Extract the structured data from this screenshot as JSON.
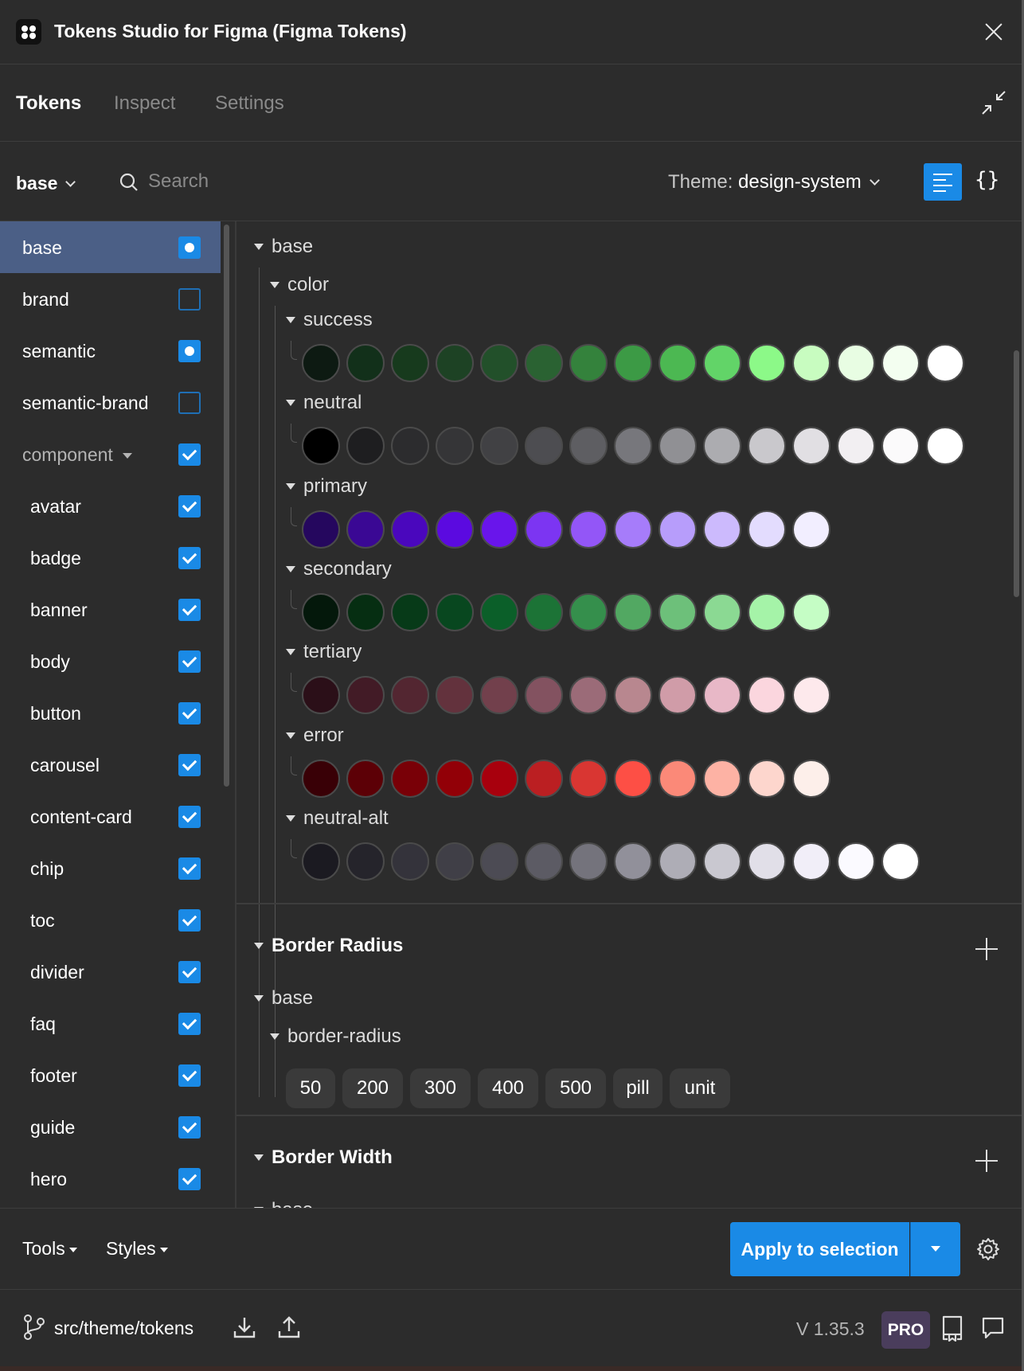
{
  "window": {
    "title": "Tokens Studio for Figma (Figma Tokens)"
  },
  "tabs": [
    {
      "label": "Tokens",
      "active": true
    },
    {
      "label": "Inspect",
      "active": false
    },
    {
      "label": "Settings",
      "active": false
    }
  ],
  "toolbar": {
    "token_set": "base",
    "search_placeholder": "Search",
    "theme_prefix": "Theme:",
    "theme_value": "design-system",
    "json_button": "{}"
  },
  "sidebar": {
    "items": [
      {
        "label": "base",
        "state": "dot",
        "selected": true,
        "child": false
      },
      {
        "label": "brand",
        "state": "empty",
        "selected": false,
        "child": false
      },
      {
        "label": "semantic",
        "state": "dot",
        "selected": false,
        "child": false
      },
      {
        "label": "semantic-brand",
        "state": "empty",
        "selected": false,
        "child": false
      },
      {
        "label": "component",
        "state": "checked",
        "selected": false,
        "child": false,
        "folder": true
      },
      {
        "label": "avatar",
        "state": "checked",
        "selected": false,
        "child": true
      },
      {
        "label": "badge",
        "state": "checked",
        "selected": false,
        "child": true
      },
      {
        "label": "banner",
        "state": "checked",
        "selected": false,
        "child": true
      },
      {
        "label": "body",
        "state": "checked",
        "selected": false,
        "child": true
      },
      {
        "label": "button",
        "state": "checked",
        "selected": false,
        "child": true
      },
      {
        "label": "carousel",
        "state": "checked",
        "selected": false,
        "child": true
      },
      {
        "label": "content-card",
        "state": "checked",
        "selected": false,
        "child": true
      },
      {
        "label": "chip",
        "state": "checked",
        "selected": false,
        "child": true
      },
      {
        "label": "toc",
        "state": "checked",
        "selected": false,
        "child": true
      },
      {
        "label": "divider",
        "state": "checked",
        "selected": false,
        "child": true
      },
      {
        "label": "faq",
        "state": "checked",
        "selected": false,
        "child": true
      },
      {
        "label": "footer",
        "state": "checked",
        "selected": false,
        "child": true
      },
      {
        "label": "guide",
        "state": "checked",
        "selected": false,
        "child": true
      },
      {
        "label": "hero",
        "state": "checked",
        "selected": false,
        "child": true
      }
    ]
  },
  "colors_section": {
    "root_label": "base",
    "sub_label": "color",
    "groups": [
      {
        "name": "success",
        "swatches": [
          "#0d1a12",
          "#12301a",
          "#173a1d",
          "#1d4224",
          "#22502a",
          "#2a6232",
          "#34823c",
          "#3c9a45",
          "#4cb852",
          "#62d468",
          "#8cf988",
          "#c8fcc0",
          "#e8fde3",
          "#f3fef0",
          "#ffffff"
        ]
      },
      {
        "name": "neutral",
        "swatches": [
          "#000000",
          "#1e1e20",
          "#2c2c2e",
          "#353537",
          "#414144",
          "#4d4d51",
          "#5e5e62",
          "#77777c",
          "#909094",
          "#acacb0",
          "#c9c8cc",
          "#e1dfe3",
          "#f2eff2",
          "#fbfafb",
          "#ffffff"
        ]
      },
      {
        "name": "primary",
        "swatches": [
          "#25075e",
          "#3a0894",
          "#4a07bd",
          "#5b0ae0",
          "#6915eb",
          "#7c35f2",
          "#9356f7",
          "#a67cfa",
          "#b79dfb",
          "#ccbafd",
          "#e3dcfe",
          "#f2eeff"
        ]
      },
      {
        "name": "secondary",
        "swatches": [
          "#04180b",
          "#062e12",
          "#073a18",
          "#08471f",
          "#0b5f29",
          "#1c7336",
          "#358f4c",
          "#52a862",
          "#6dc07a",
          "#8bd993",
          "#a5f3a8",
          "#c5fdc5"
        ]
      },
      {
        "name": "tertiary",
        "swatches": [
          "#2b0f18",
          "#421b26",
          "#532631",
          "#63323d",
          "#72404c",
          "#835260",
          "#9b6b78",
          "#b8878f",
          "#d09ca8",
          "#e8b8c7",
          "#fbd6de",
          "#fde9ec"
        ]
      },
      {
        "name": "error",
        "swatches": [
          "#390006",
          "#5c0006",
          "#790007",
          "#920007",
          "#a8000d",
          "#bb1f22",
          "#d93632",
          "#fd4f45",
          "#fb8978",
          "#fdb2a4",
          "#fdd6cd",
          "#fdefea"
        ]
      },
      {
        "name": "neutral-alt",
        "swatches": [
          "#1b1a21",
          "#25242b",
          "#34333b",
          "#403f47",
          "#4c4b54",
          "#5c5b64",
          "#74737c",
          "#91909a",
          "#aeadb6",
          "#c9c8d0",
          "#e1dfe8",
          "#f1eef8",
          "#fbfaff",
          "#ffffff"
        ]
      }
    ]
  },
  "border_radius": {
    "title": "Border Radius",
    "root_label": "base",
    "sub_label": "border-radius",
    "tokens": [
      "50",
      "200",
      "300",
      "400",
      "500",
      "pill",
      "unit"
    ]
  },
  "border_width": {
    "title": "Border Width",
    "root_label": "base"
  },
  "footer": {
    "tools_label": "Tools",
    "styles_label": "Styles",
    "apply_label": "Apply to selection",
    "repo_path": "src/theme/tokens",
    "version": "V 1.35.3",
    "plan_badge": "PRO"
  },
  "accent_color": "#1a8ae6"
}
